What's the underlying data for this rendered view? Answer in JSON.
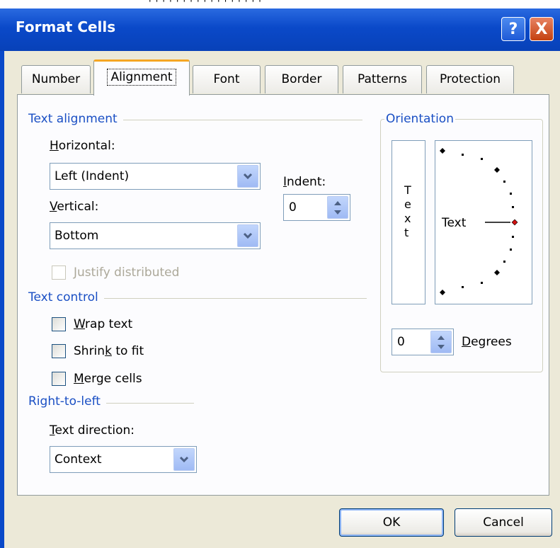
{
  "top_fragment": "' ' ' ' ' ' ' ' ' ' ' ' ' ' ' ' '",
  "dialog": {
    "title": "Format Cells",
    "help_glyph": "?",
    "close_glyph": "X",
    "accent_color": "#0a49c9"
  },
  "tabs": [
    {
      "label": "Number",
      "active": false
    },
    {
      "label": "Alignment",
      "active": true
    },
    {
      "label": "Font",
      "active": false
    },
    {
      "label": "Border",
      "active": false
    },
    {
      "label": "Patterns",
      "active": false
    },
    {
      "label": "Protection",
      "active": false
    }
  ],
  "text_alignment": {
    "section_label": "Text alignment",
    "horizontal_label_hotkey": "H",
    "horizontal_label_rest": "orizontal:",
    "horizontal_value": "Left (Indent)",
    "vertical_label_hotkey": "V",
    "vertical_label_rest": "ertical:",
    "vertical_value": "Bottom",
    "indent_label_hotkey": "I",
    "indent_label_rest": "ndent:",
    "indent_value": "0",
    "justify_distributed_label": "Justify distributed"
  },
  "text_control": {
    "section_label": "Text control",
    "wrap_hotkey": "W",
    "wrap_rest": "rap text",
    "shrink_pre": "Shrin",
    "shrink_hotkey": "k",
    "shrink_post": " to fit",
    "merge_hotkey": "M",
    "merge_rest": "erge cells"
  },
  "right_to_left": {
    "section_label": "Right-to-left",
    "direction_label_hotkey": "T",
    "direction_label_rest": "ext direction:",
    "direction_value": "Context"
  },
  "orientation": {
    "section_label": "Orientation",
    "vertical_letters": [
      "T",
      "e",
      "x",
      "t"
    ],
    "dial_text": "Text",
    "degrees_value": "0",
    "degrees_label_hotkey": "D",
    "degrees_label_rest": "egrees",
    "selected_marker_color": "#d01010"
  },
  "buttons": {
    "ok": "OK",
    "cancel": "Cancel"
  }
}
